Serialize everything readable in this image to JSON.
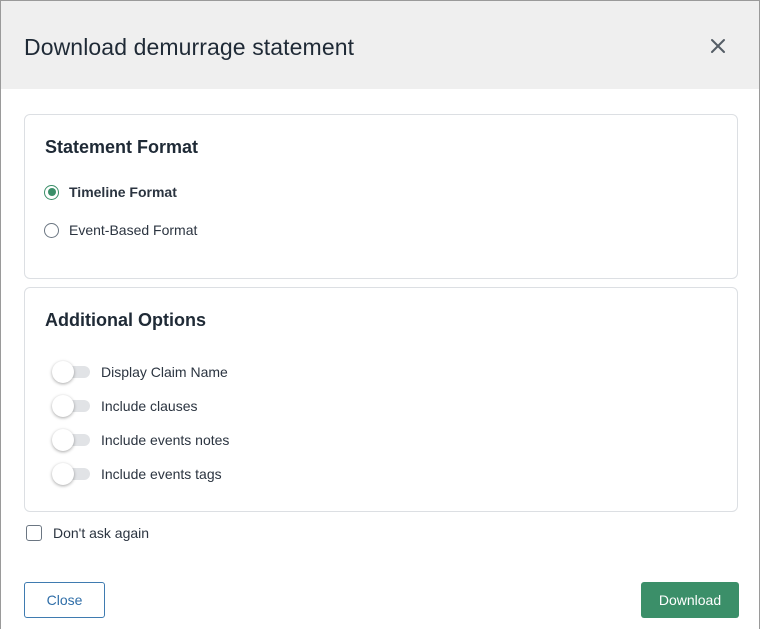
{
  "dialog": {
    "title": "Download demurrage statement",
    "close_icon": "close-icon"
  },
  "statement_format": {
    "heading": "Statement Format",
    "options": [
      {
        "label": "Timeline Format",
        "selected": true
      },
      {
        "label": "Event-Based Format",
        "selected": false
      }
    ]
  },
  "additional_options": {
    "heading": "Additional Options",
    "toggles": [
      {
        "label": "Display Claim Name",
        "on": false
      },
      {
        "label": "Include clauses",
        "on": false
      },
      {
        "label": "Include events notes",
        "on": false
      },
      {
        "label": "Include events tags",
        "on": false
      }
    ]
  },
  "dont_ask": {
    "label": "Don't ask again",
    "checked": false
  },
  "footer": {
    "close_label": "Close",
    "download_label": "Download"
  },
  "colors": {
    "accent": "#3b8f69",
    "link": "#2f6ea8",
    "header_bg": "#efefef"
  }
}
